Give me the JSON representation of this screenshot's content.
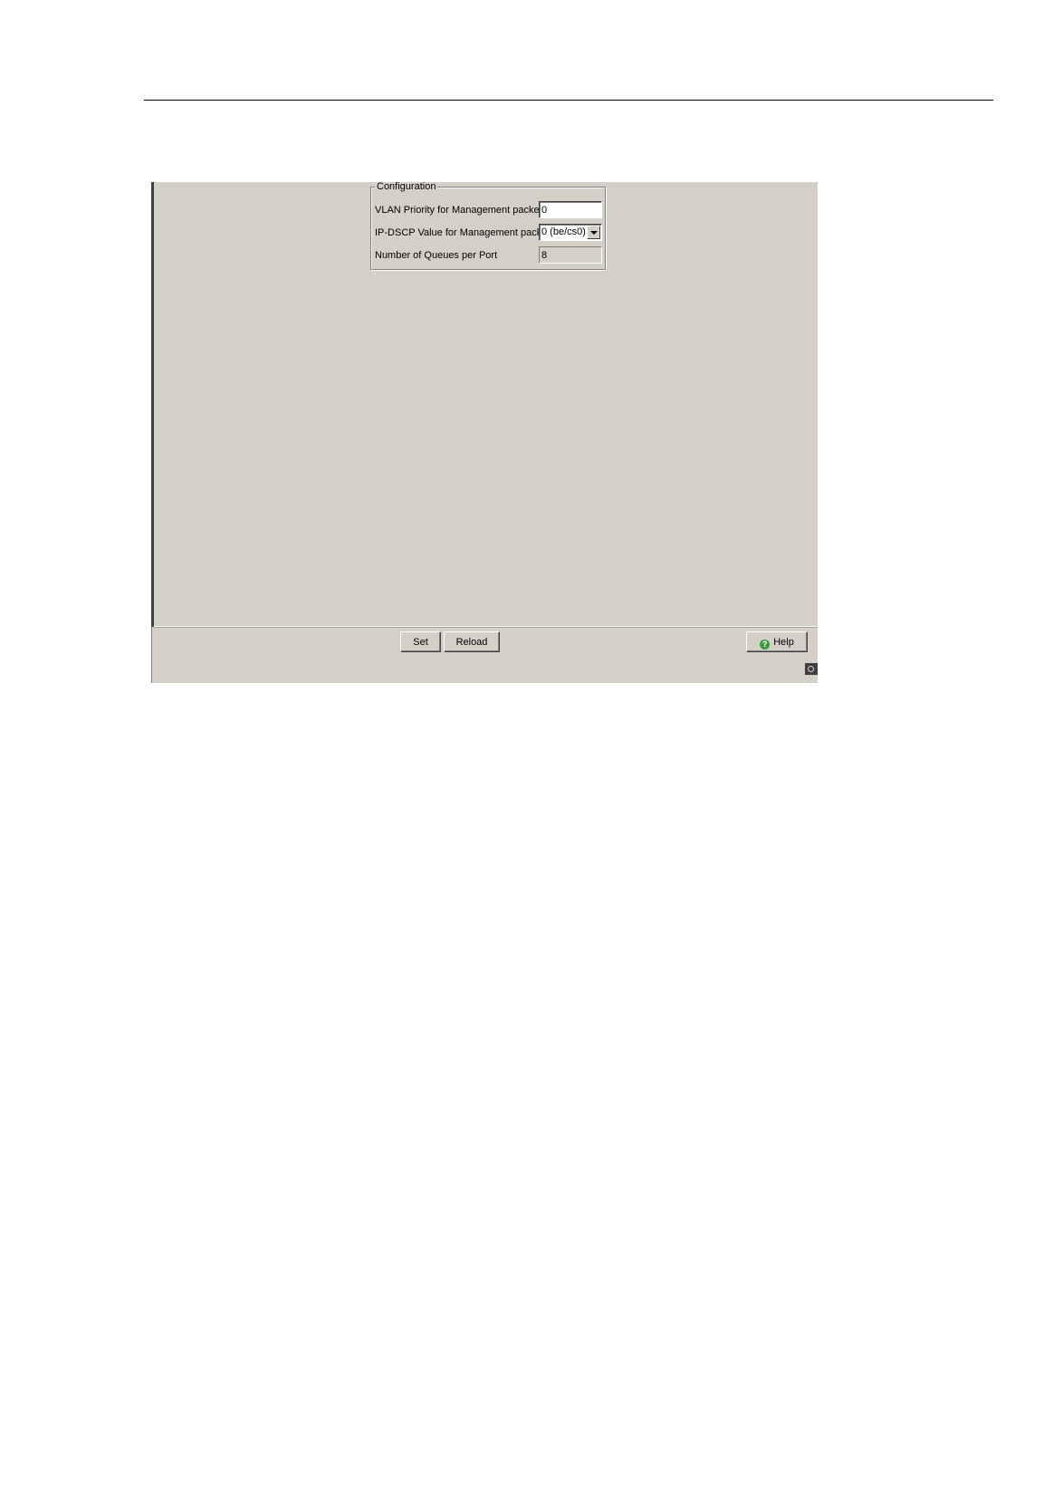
{
  "configuration": {
    "title": "Configuration",
    "vlan_priority": {
      "label": "VLAN Priority for Management packets",
      "value": "0"
    },
    "ip_dscp": {
      "label": "IP-DSCP Value for Management packets",
      "selected": "0 (be/cs0)"
    },
    "queues": {
      "label": "Number of Queues per Port",
      "value": "8"
    }
  },
  "toolbar": {
    "set_label": "Set",
    "reload_label": "Reload",
    "help_label": "Help"
  },
  "icons": {
    "help": "help-icon",
    "dropdown": "chevron-down-icon",
    "resize": "resize-grip-icon"
  },
  "colors": {
    "window_background": "#d4d0c8",
    "help_icon": "#3a9a3a"
  }
}
